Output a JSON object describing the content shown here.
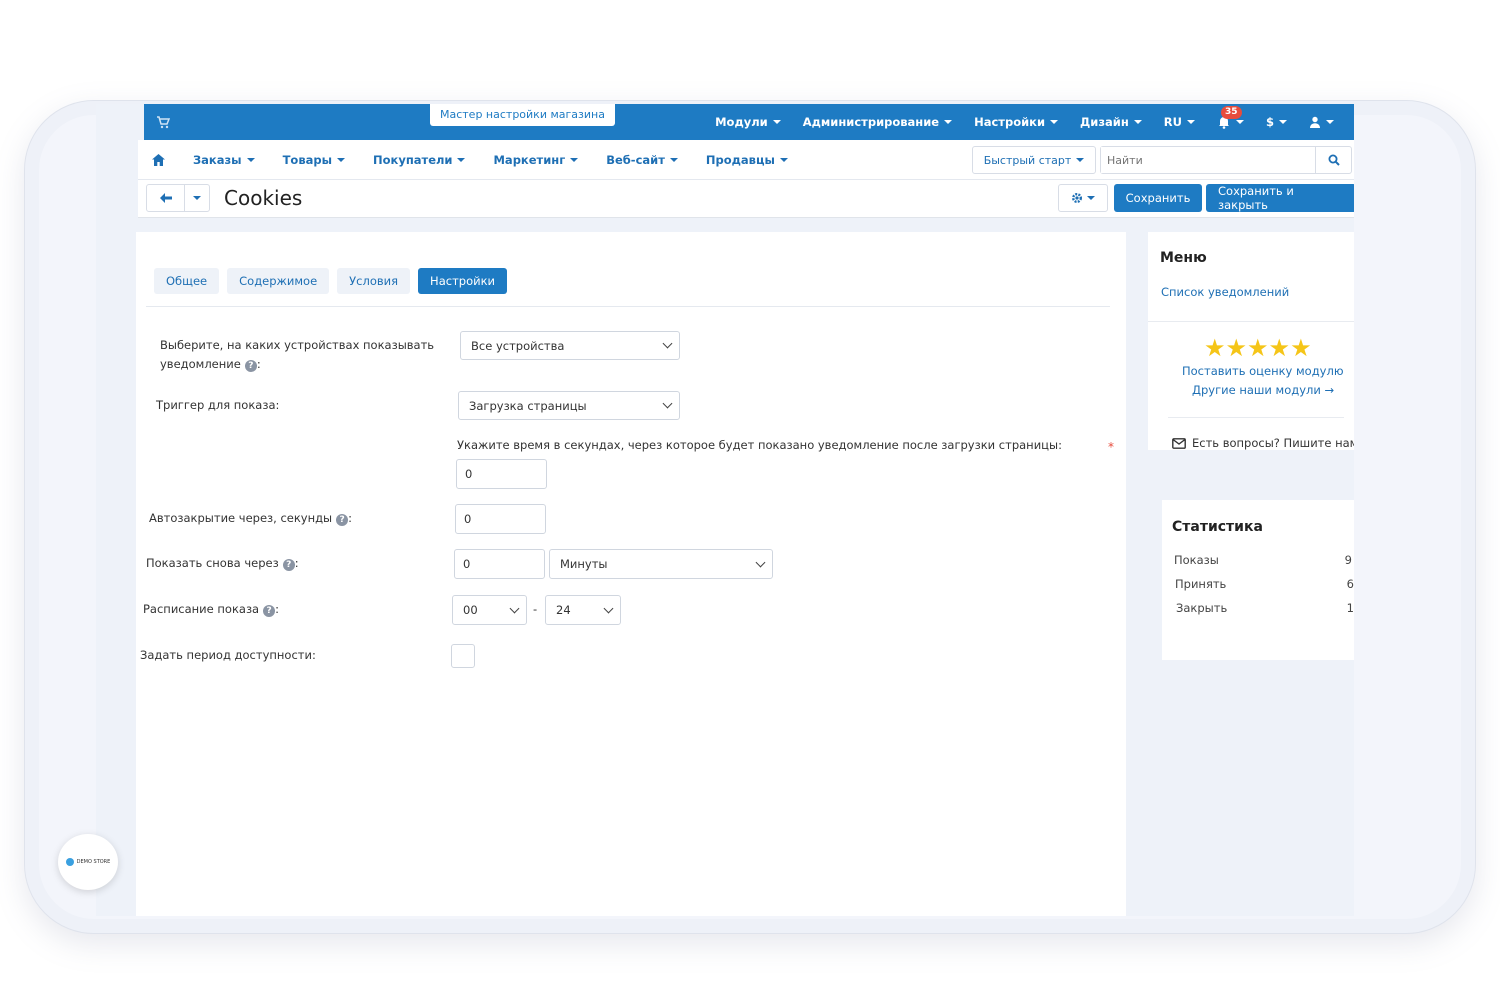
{
  "wizard_label": "Мастер настройки магазина",
  "top_menu": [
    "Модули",
    "Администрирование",
    "Настройки",
    "Дизайн",
    "RU"
  ],
  "notifications_count": "35",
  "currency_label": "$",
  "nav": [
    "Заказы",
    "Товары",
    "Покупатели",
    "Маркетинг",
    "Веб-сайт",
    "Продавцы"
  ],
  "quick_start_label": "Быстрый старт",
  "search_placeholder": "Найти",
  "page_title": "Cookies",
  "save_label": "Сохранить",
  "save_close_label": "Сохранить и закрыть",
  "tabs": [
    "Общее",
    "Содержимое",
    "Условия",
    "Настройки"
  ],
  "form": {
    "devices_label_1": "Выберите, на каких устройствах показывать",
    "devices_label_2": "уведомление",
    "devices_value": "Все устройства",
    "trigger_label": "Триггер для показа:",
    "trigger_value": "Загрузка страницы",
    "delay_note": "Укажите время в секундах, через которое будет показано уведомление после загрузки страницы:",
    "required_mark": "*",
    "delay_value": "0",
    "autoclose_label": "Автозакрытие через, секунды",
    "autoclose_value": "0",
    "repeat_label": "Показать снова через",
    "repeat_value": "0",
    "repeat_unit": "Минуты",
    "schedule_label": "Расписание показа",
    "schedule_from": "00",
    "schedule_sep": "-",
    "schedule_to": "24",
    "period_label": "Задать период доступности:",
    "help_glyph": "?",
    "colon": ":"
  },
  "sidebar": {
    "menu_title": "Меню",
    "menu_link": "Список уведомлений",
    "stars": "★★★★★",
    "rate_link": "Поставить оценку модулю",
    "other_link": "Другие наши модули →",
    "contact": "Есть вопросы? Пишите нам!",
    "stats_title": "Статистика",
    "stats": [
      {
        "label": "Показы",
        "value": "9"
      },
      {
        "label": "Принять",
        "value": "6"
      },
      {
        "label": "Закрыть",
        "value": "1"
      }
    ]
  },
  "demo_badge": "DEMO STORE",
  "colors": {
    "primary": "#1e7bc3",
    "link": "#1e6fb4",
    "star": "#f5c518",
    "badge": "#e74c3c"
  }
}
